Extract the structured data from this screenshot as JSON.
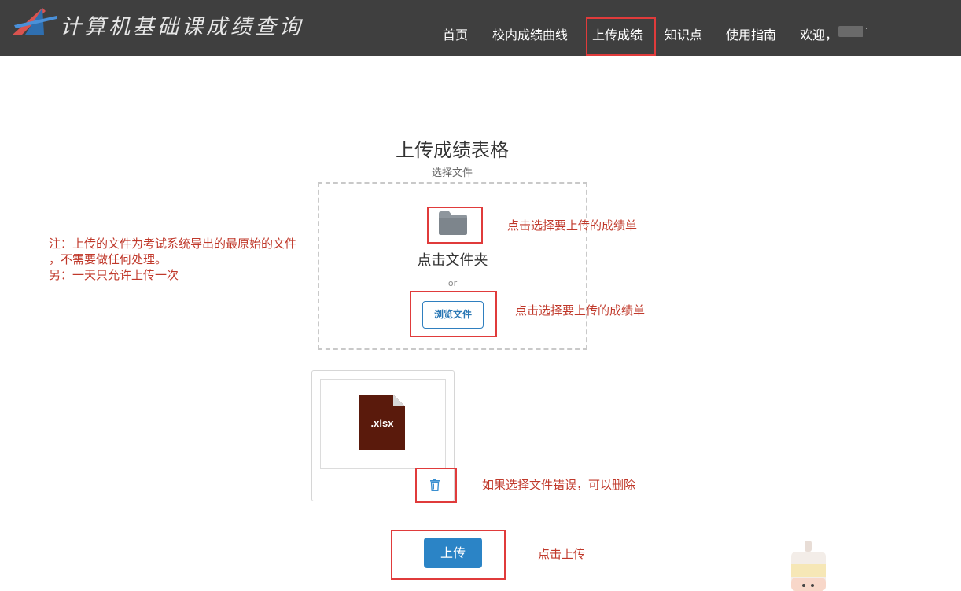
{
  "header": {
    "logo_text": "计算机基础课成绩查询",
    "nav": [
      "首页",
      "校内成绩曲线",
      "上传成绩",
      "知识点",
      "使用指南",
      "欢迎，"
    ],
    "user_suffix": "·"
  },
  "upload": {
    "title": "上传成绩表格",
    "subtitle": "选择文件",
    "drop_text": "点击文件夹",
    "or_text": "or",
    "browse_label": "浏览文件",
    "file_ext": ".xlsx",
    "upload_label": "上传"
  },
  "annotations": {
    "folder_hint": "点击选择要上传的成绩单",
    "browse_hint": "点击选择要上传的成绩单",
    "delete_hint": "如果选择文件错误，可以删除",
    "upload_hint": "点击上传",
    "note_lines": [
      "注：上传的文件为考试系统导出的最原始的文件",
      "，不需要做任何处理。",
      "另：一天只允许上传一次"
    ]
  },
  "colors": {
    "navbar": "#3f3f3f",
    "highlight": "#e03b3b",
    "annotation": "#c0392b",
    "primary": "#2b84c6",
    "file_icon": "#5a1a0c"
  },
  "icons": {
    "logo": "logo-mark-icon",
    "folder": "folder-icon",
    "file": "xlsx-file-icon",
    "trash": "trash-icon"
  }
}
